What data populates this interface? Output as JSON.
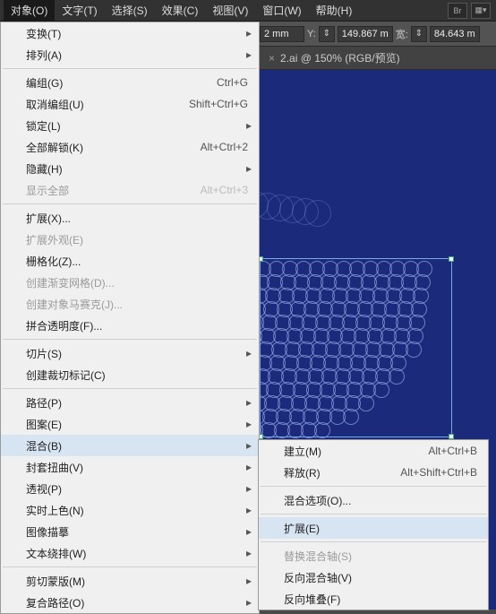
{
  "menubar": {
    "items": [
      "对象(O)",
      "文字(T)",
      "选择(S)",
      "效果(C)",
      "视图(V)",
      "窗口(W)",
      "帮助(H)"
    ],
    "icons": [
      "Br",
      "▦▾"
    ]
  },
  "toolbar": {
    "x_val": "2 mm",
    "y_lbl": "Y:",
    "y_val": "149.867 m",
    "w_lbl": "宽:",
    "w_val": "84.643 m"
  },
  "tab": {
    "title": "2.ai @ 150% (RGB/预览)",
    "close": "×"
  },
  "menu1": {
    "g1": [
      {
        "label": "变换(T)",
        "arrow": true
      },
      {
        "label": "排列(A)",
        "arrow": true
      }
    ],
    "g2": [
      {
        "label": "编组(G)",
        "sc": "Ctrl+G"
      },
      {
        "label": "取消编组(U)",
        "sc": "Shift+Ctrl+G"
      },
      {
        "label": "锁定(L)",
        "arrow": true
      },
      {
        "label": "全部解锁(K)",
        "sc": "Alt+Ctrl+2"
      },
      {
        "label": "隐藏(H)",
        "arrow": true
      },
      {
        "label": "显示全部",
        "sc": "Alt+Ctrl+3",
        "disabled": true
      }
    ],
    "g3": [
      {
        "label": "扩展(X)..."
      },
      {
        "label": "扩展外观(E)",
        "disabled": true
      },
      {
        "label": "栅格化(Z)..."
      },
      {
        "label": "创建渐变网格(D)...",
        "disabled": true
      },
      {
        "label": "创建对象马赛克(J)...",
        "disabled": true
      },
      {
        "label": "拼合透明度(F)..."
      }
    ],
    "g4": [
      {
        "label": "切片(S)",
        "arrow": true
      },
      {
        "label": "创建裁切标记(C)"
      }
    ],
    "g5": [
      {
        "label": "路径(P)",
        "arrow": true
      },
      {
        "label": "图案(E)",
        "arrow": true
      },
      {
        "label": "混合(B)",
        "arrow": true,
        "hover": true
      },
      {
        "label": "封套扭曲(V)",
        "arrow": true
      },
      {
        "label": "透视(P)",
        "arrow": true
      },
      {
        "label": "实时上色(N)",
        "arrow": true
      },
      {
        "label": "图像描摹",
        "arrow": true
      },
      {
        "label": "文本绕排(W)",
        "arrow": true
      }
    ],
    "g6": [
      {
        "label": "剪切蒙版(M)",
        "arrow": true
      },
      {
        "label": "复合路径(O)",
        "arrow": true
      }
    ]
  },
  "menu2": {
    "g1": [
      {
        "label": "建立(M)",
        "sc": "Alt+Ctrl+B"
      },
      {
        "label": "释放(R)",
        "sc": "Alt+Shift+Ctrl+B"
      }
    ],
    "g2": [
      {
        "label": "混合选项(O)..."
      }
    ],
    "g3": [
      {
        "label": "扩展(E)",
        "hover": true
      }
    ],
    "g4": [
      {
        "label": "替换混合轴(S)",
        "disabled": true
      },
      {
        "label": "反向混合轴(V)"
      },
      {
        "label": "反向堆叠(F)"
      }
    ]
  }
}
